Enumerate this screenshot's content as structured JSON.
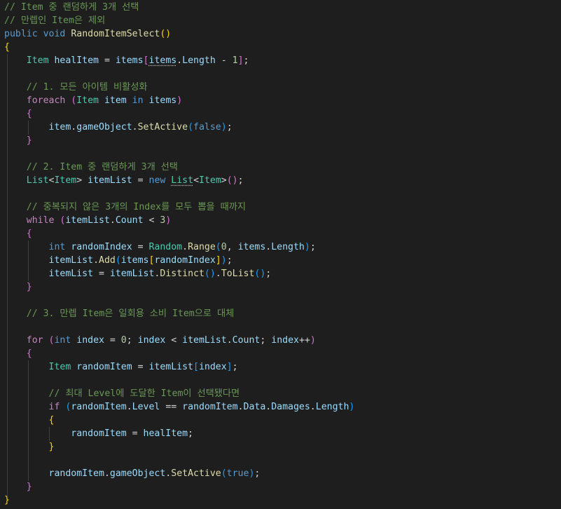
{
  "code": {
    "c_title1": "// Item 중 랜덤하게 3개 선택",
    "c_title2": "// 만렙인 Item은 제외",
    "method": {
      "public": "public",
      "void": "void",
      "name": "RandomItemSelect",
      "parens": "()"
    },
    "brace_open": "{",
    "brace_close": "}",
    "heal_line": {
      "type": "Item",
      "var": "healItem",
      "eq": " = ",
      "items": "items",
      "bracket_open": "[",
      "items2": "items",
      "dot": ".",
      "length": "Length",
      "minus": " - ",
      "one": "1",
      "bracket_close": "]",
      "semi": ";"
    },
    "c_step1": "// 1. 모든 아이템 비활성화",
    "foreach_line": {
      "kw": "foreach",
      "paren_open": " (",
      "type": "Item",
      "var": "item",
      "in": "in",
      "items": "items",
      "paren_close": ")"
    },
    "setactive_false": {
      "obj": "item",
      "dot1": ".",
      "prop": "gameObject",
      "dot2": ".",
      "fn": "SetActive",
      "paren_open": "(",
      "value": "false",
      "paren_close": ")",
      "semi": ";"
    },
    "c_step2": "// 2. Item 중 랜덤하게 3개 선택",
    "list_line": {
      "type": "List",
      "lt": "<",
      "gen": "Item",
      "gt": ">",
      "var": "itemList",
      "eq": " = ",
      "new": "new",
      "type2": "List",
      "lt2": "<",
      "gen2": "Item",
      "gt2": ">",
      "parens": "()",
      "semi": ";"
    },
    "c_dedupe": "// 중복되지 않은 3개의 Index를 모두 뽑을 때까지",
    "while_line": {
      "kw": "while",
      "paren_open": " (",
      "var": "itemList",
      "dot": ".",
      "prop": "Count",
      "lt": " < ",
      "num": "3",
      "paren_close": ")"
    },
    "rand_line": {
      "int": "int",
      "var": "randomIndex",
      "eq": " = ",
      "cls": "Random",
      "dot": ".",
      "fn": "Range",
      "paren_open": "(",
      "zero": "0",
      "comma": ", ",
      "items": "items",
      "dot2": ".",
      "length": "Length",
      "paren_close": ")",
      "semi": ";"
    },
    "add_line": {
      "var": "itemList",
      "dot": ".",
      "fn": "Add",
      "paren_open": "(",
      "items": "items",
      "bracket_open": "[",
      "idx": "randomIndex",
      "bracket_close": "]",
      "paren_close": ")",
      "semi": ";"
    },
    "distinct_line": {
      "var": "itemList",
      "eq": " = ",
      "var2": "itemList",
      "dot": ".",
      "fn": "Distinct",
      "parens1": "()",
      "dot2": ".",
      "fn2": "ToList",
      "parens2": "()",
      "semi": ";"
    },
    "c_step3": "// 3. 만렙 Item은 일회용 소비 Item으로 대체",
    "for_line": {
      "kw": "for",
      "paren_open": " (",
      "int": "int",
      "var": "index",
      "eq": " = ",
      "zero": "0",
      "semi1": "; ",
      "var2": "index",
      "lt": " < ",
      "list": "itemList",
      "dot": ".",
      "prop": "Count",
      "semi2": "; ",
      "var3": "index",
      "inc": "++",
      "paren_close": ")"
    },
    "randitem_line": {
      "type": "Item",
      "var": "randomItem",
      "eq": " = ",
      "list": "itemList",
      "bracket_open": "[",
      "idx": "index",
      "bracket_close": "]",
      "semi": ";"
    },
    "c_maxlevel": "// 최대 Level에 도달한 Item이 선택됐다면",
    "if_line": {
      "kw": "if",
      "paren_open": " (",
      "var": "randomItem",
      "dot": ".",
      "prop": "Level",
      "eqeq": " == ",
      "var2": "randomItem",
      "dot2": ".",
      "prop2": "Data",
      "dot3": ".",
      "prop3": "Damages",
      "dot4": ".",
      "prop4": "Length",
      "paren_close": ")"
    },
    "assign_line": {
      "var": "randomItem",
      "eq": " = ",
      "var2": "healItem",
      "semi": ";"
    },
    "setactive_true": {
      "obj": "randomItem",
      "dot1": ".",
      "prop": "gameObject",
      "dot2": ".",
      "fn": "SetActive",
      "paren_open": "(",
      "value": "true",
      "paren_close": ")",
      "semi": ";"
    }
  }
}
